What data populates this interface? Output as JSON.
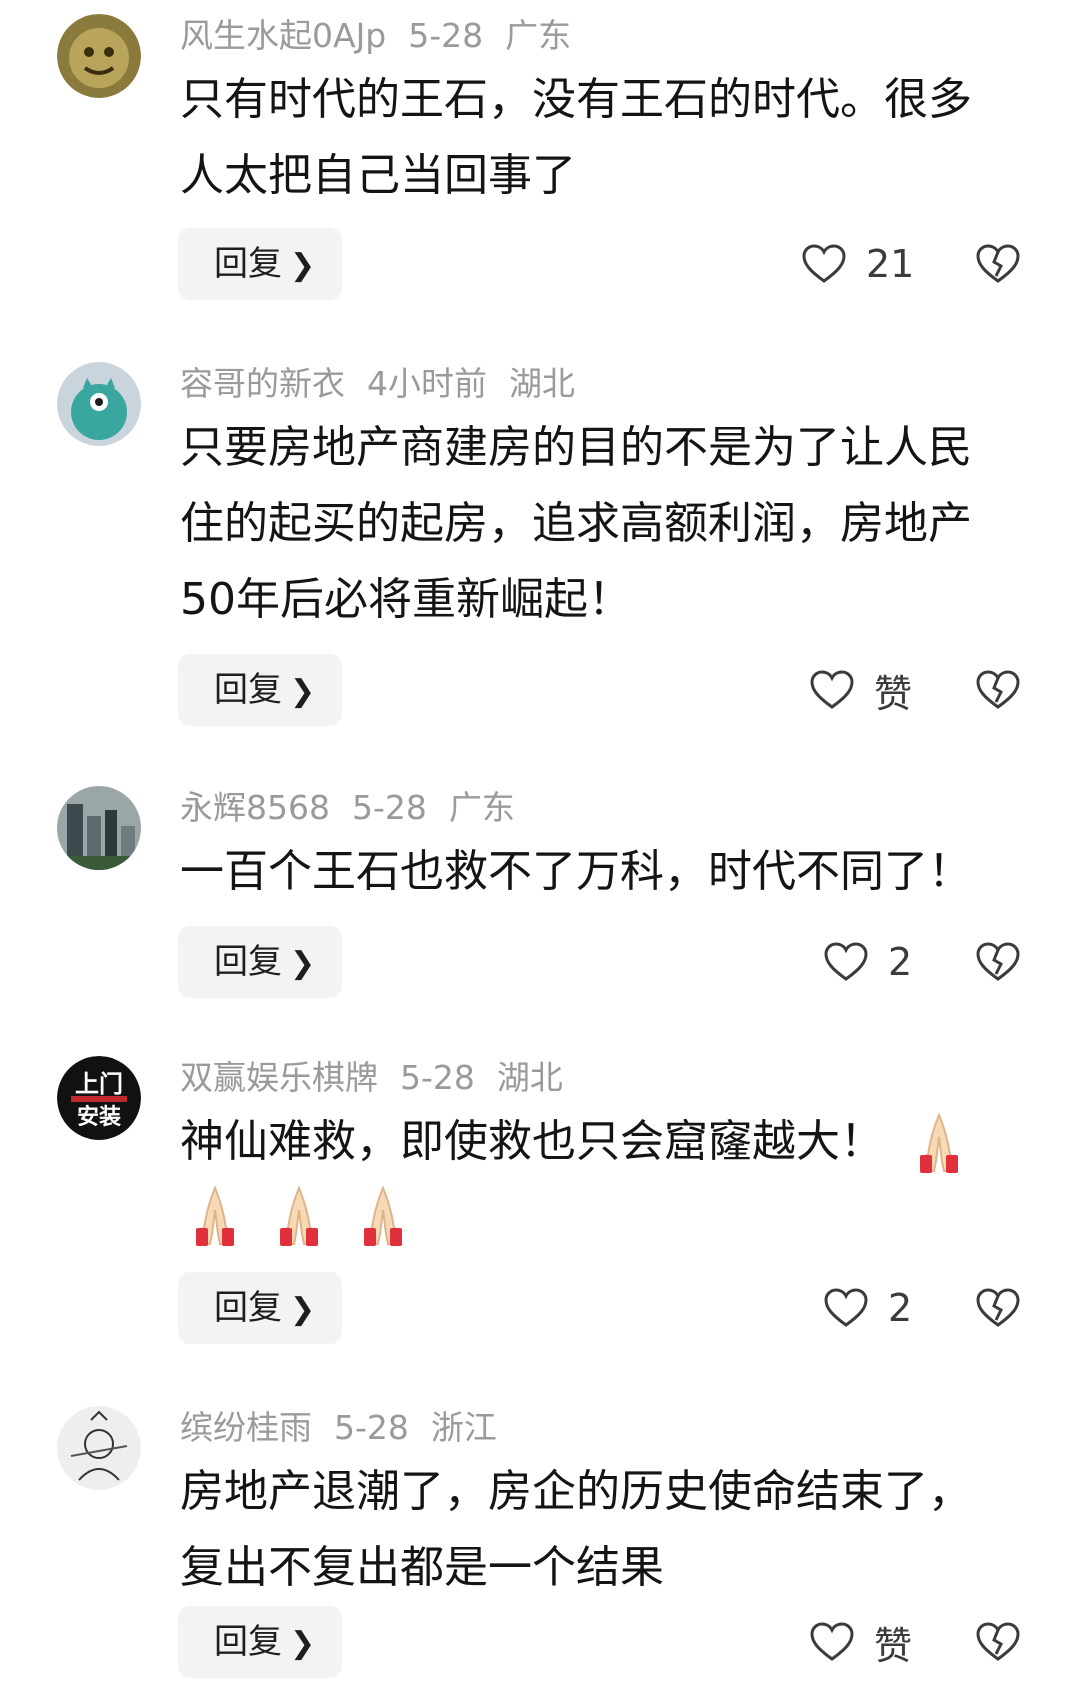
{
  "comments": [
    {
      "username": "风生水起0AJp",
      "time": "5-28",
      "location": "广东",
      "text_lines": [
        "只有时代的王石，没有王石的时代。很多",
        "人太把自己当回事了"
      ],
      "reply_label": "回复",
      "like_count": "21"
    },
    {
      "username": "容哥的新衣",
      "time": "4小时前",
      "location": "湖北",
      "text_lines": [
        "只要房地产商建房的目的不是为了让人民",
        "住的起买的起房，追求高额利润，房地产",
        "50年后必将重新崛起！"
      ],
      "reply_label": "回复",
      "like_count": "赞"
    },
    {
      "username": "永辉8568",
      "time": "5-28",
      "location": "广东",
      "text_lines": [
        "一百个王石也救不了万科，时代不同了！"
      ],
      "reply_label": "回复",
      "like_count": "2"
    },
    {
      "username": "双赢娱乐棋牌",
      "time": "5-28",
      "location": "湖北",
      "avatar_text": [
        "上门",
        "安装"
      ],
      "text_lines": [
        "神仙难救，即使救也只会窟窿越大！"
      ],
      "emoji": "pray-emoji",
      "reply_label": "回复",
      "like_count": "2"
    },
    {
      "username": "缤纷桂雨",
      "time": "5-28",
      "location": "浙江",
      "text_lines": [
        "房地产退潮了，房企的历史使命结束了，",
        "复出不复出都是一个结果"
      ],
      "reply_label": "回复",
      "like_count": "赞"
    }
  ],
  "icons": {
    "like": "heart-outline-icon",
    "dislike": "broken-heart-icon",
    "reply_chevron": "chevron-right-icon"
  },
  "colors": {
    "meta": "#9a9a9a",
    "reply_bg": "#f3f3f3",
    "icon": "#3b3b3b"
  }
}
